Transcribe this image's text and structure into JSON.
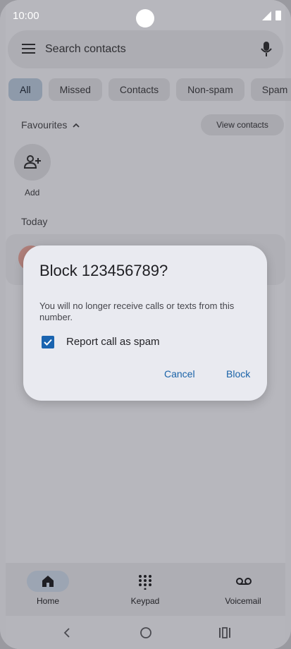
{
  "status_bar": {
    "time": "10:00"
  },
  "search": {
    "placeholder": "Search contacts"
  },
  "chips": [
    {
      "label": "All",
      "active": true
    },
    {
      "label": "Missed",
      "active": false
    },
    {
      "label": "Contacts",
      "active": false
    },
    {
      "label": "Non-spam",
      "active": false
    },
    {
      "label": "Spam",
      "active": false
    }
  ],
  "favourites": {
    "title": "Favourites",
    "view_contacts": "View contacts",
    "add_label": "Add"
  },
  "recents": {
    "section_title": "Today"
  },
  "dialog": {
    "title": "Block 123456789?",
    "message": "You will no longer receive calls or texts from this number.",
    "checkbox_label": "Report call as spam",
    "checkbox_checked": true,
    "cancel": "Cancel",
    "confirm": "Block"
  },
  "bottom_nav": [
    {
      "label": "Home",
      "icon": "home-icon",
      "active": true
    },
    {
      "label": "Keypad",
      "icon": "dialpad-icon",
      "active": false
    },
    {
      "label": "Voicemail",
      "icon": "voicemail-icon",
      "active": false
    }
  ],
  "colors": {
    "accent": "#1a63a8",
    "dialog_bg": "#e9eaf0",
    "scrim": "#b7b7bd"
  }
}
